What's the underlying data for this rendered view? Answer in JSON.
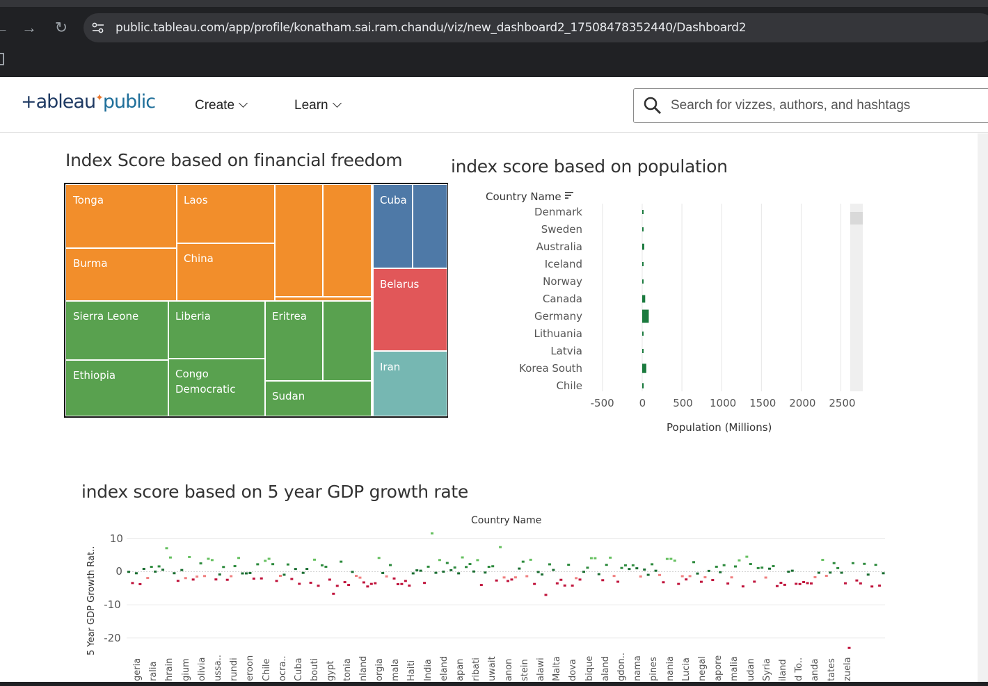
{
  "browser": {
    "url": "public.tableau.com/app/profile/konatham.sai.ram.chandu/viz/new_dashboard2_17508478352440/Dashboard2",
    "back_icon": "arrow-left-icon",
    "forward_icon": "arrow-right-icon",
    "reload_icon": "reload-icon"
  },
  "header": {
    "logo_part1": "+ableau",
    "logo_part2": "public",
    "nav_create": "Create",
    "nav_learn": "Learn",
    "search_placeholder": "Search for vizzes, authors, and hashtags"
  },
  "colors": {
    "orange": "#f28e2b",
    "green": "#59a14f",
    "blue": "#4e79a7",
    "red": "#e15759",
    "teal": "#76b7b2",
    "bar_green": "#1b7a3e"
  },
  "treemap": {
    "title": "Index Score based on financial freedom",
    "labels": [
      "Tonga",
      "Laos",
      "Burma",
      "China",
      "Cuba",
      "Belarus",
      "Sierra Leone",
      "Liberia",
      "Eritrea",
      "Ethiopia",
      "Congo",
      "Democratic",
      "Sudan",
      "Iran"
    ]
  },
  "population": {
    "title": "index score based on population",
    "field_header": "Country Name",
    "axis_title": "Population (Millions)",
    "chart_data": {
      "type": "bar",
      "orientation": "horizontal",
      "categories": [
        "Denmark",
        "Sweden",
        "Australia",
        "Iceland",
        "Norway",
        "Canada",
        "Germany",
        "Lithuania",
        "Latvia",
        "Korea South",
        "Chile"
      ],
      "values": [
        6,
        10,
        26,
        0.4,
        5,
        38,
        83,
        3,
        2,
        52,
        19
      ],
      "xlabel": "Population (Millions)",
      "ylabel": "Country Name",
      "xlim": [
        -700,
        2600
      ],
      "ticks": [
        "-500",
        "0",
        "500",
        "1000",
        "1500",
        "2000",
        "2500"
      ]
    }
  },
  "gdp": {
    "title": "index score based on 5 year GDP growth rate",
    "top_header": "Country Name",
    "y_axis_title": "5 Year GDP Growth Rat..",
    "y_ticks": [
      "10",
      "0",
      "-10",
      "-20"
    ],
    "chart_data": {
      "type": "scatter",
      "ylim": [
        -24,
        12
      ],
      "ylabel": "5 Year GDP Growth Rat..",
      "categories_visible": [
        "geria",
        "ralia",
        "hrain",
        "gium",
        "olivia",
        "ussa..",
        "rundi",
        "eroon",
        "Chile",
        "ocra..",
        "Cuba",
        "bouti",
        "gypt",
        "tonia",
        "nland",
        "orgia",
        "mala",
        "Haiti",
        "India",
        "eland",
        "apan",
        "ribati",
        "uwait",
        "anon",
        "stein",
        "alawi",
        "Malta",
        "dova",
        "bique",
        "aland",
        "gdon..",
        "nama",
        "pines",
        "nania",
        "Lucia",
        "negal",
        "apore",
        "malia",
        "udan",
        "Syria",
        "iland",
        "d To..",
        "anda",
        "tates",
        "zuela"
      ]
    }
  }
}
